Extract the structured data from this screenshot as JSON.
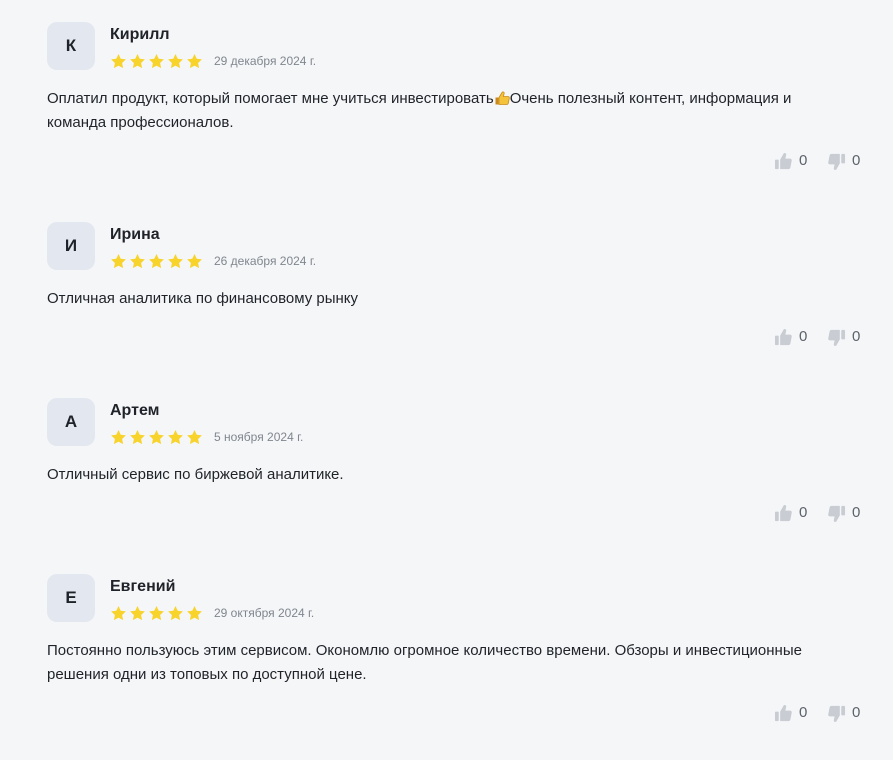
{
  "reviews": [
    {
      "initial": "К",
      "author": "Кирилл",
      "rating": 5,
      "date": "29 декабря 2024 г.",
      "text_before_emoji": "Оплатил продукт, который помогает мне учиться инвестировать",
      "emoji": "thumbs-up-emoji",
      "text_after_emoji": "Очень полезный контент, информация и команда профессионалов.",
      "likes": "0",
      "dislikes": "0"
    },
    {
      "initial": "И",
      "author": "Ирина",
      "rating": 5,
      "date": "26 декабря 2024 г.",
      "text": "Отличная аналитика по финансовому рынку",
      "likes": "0",
      "dislikes": "0"
    },
    {
      "initial": "А",
      "author": "Артем",
      "rating": 5,
      "date": "5 ноября 2024 г.",
      "text": "Отличный сервис по биржевой аналитике.",
      "likes": "0",
      "dislikes": "0"
    },
    {
      "initial": "Е",
      "author": "Евгений",
      "rating": 5,
      "date": "29 октября 2024 г.",
      "text": "Постоянно пользуюсь этим сервисом. Окономлю огромное количество времени. Обзоры и инвестиционные решения одни из топовых по доступной цене.",
      "likes": "0",
      "dislikes": "0"
    }
  ],
  "colors": {
    "star": "#f7d32b",
    "avatar_bg": "#e3e7ef",
    "page_bg": "#f5f6f8",
    "vote_icon": "#c9cdd3"
  },
  "icons": {
    "star": "star-icon",
    "like": "thumbs-up-icon",
    "dislike": "thumbs-down-icon"
  }
}
